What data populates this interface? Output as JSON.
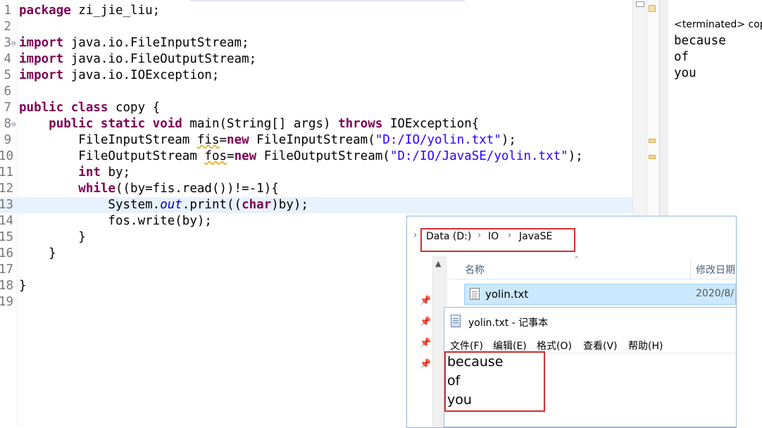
{
  "editor": {
    "lines": [
      {
        "n": "1",
        "html": "<span class='kw'>package</span> zi_jie_liu;"
      },
      {
        "n": "2",
        "html": ""
      },
      {
        "n": "3",
        "html": "<span class='kw'>import</span> java.io.FileInputStream;",
        "fold": true
      },
      {
        "n": "4",
        "html": "<span class='kw'>import</span> java.io.FileOutputStream;"
      },
      {
        "n": "5",
        "html": "<span class='kw'>import</span> java.io.IOException;"
      },
      {
        "n": "6",
        "html": ""
      },
      {
        "n": "7",
        "html": "<span class='kw'>public class</span> copy {"
      },
      {
        "n": "8",
        "html": "    <span class='kw'>public static void</span> main(String[] args) <span class='kw'>throws</span> IOException{",
        "fold": true
      },
      {
        "n": "9",
        "html": "        FileInputStream <span class='warn'>fis</span>=<span class='kw'>new</span> FileInputStream(<span class='str'>\"D:/IO/yolin.txt\"</span>);"
      },
      {
        "n": "10",
        "html": "        FileOutputStream <span class='warn'>fos</span>=<span class='kw'>new</span> FileOutputStream(<span class='str'>\"D:/IO/JavaSE/yolin.txt\"</span>);"
      },
      {
        "n": "11",
        "html": "        <span class='kw'>int</span> by;"
      },
      {
        "n": "12",
        "html": "        <span class='kw'>while</span>((by=fis.read())!=-1){"
      },
      {
        "n": "13",
        "html": "            System.<span class='fld'>out</span>.print((<span class='kw'>char</span>)by);",
        "current": true
      },
      {
        "n": "14",
        "html": "            fos.write(by);"
      },
      {
        "n": "15",
        "html": "        }"
      },
      {
        "n": "16",
        "html": "    }"
      },
      {
        "n": "17",
        "html": ""
      },
      {
        "n": "18",
        "html": "}"
      },
      {
        "n": "19",
        "html": ""
      }
    ]
  },
  "console": {
    "title": "<terminated> cop",
    "output": [
      "because",
      "of",
      "you"
    ]
  },
  "explorer": {
    "breadcrumb": [
      "Data (D:)",
      "IO",
      "JavaSE"
    ],
    "col_name": "名称",
    "col_date": "修改日期",
    "file": {
      "name": "yolin.txt",
      "date": "2020/8/"
    }
  },
  "notepad": {
    "title": "yolin.txt - 记事本",
    "menus": [
      "文件(F)",
      "编辑(E)",
      "格式(O)",
      "查看(V)",
      "帮助(H)"
    ],
    "content": [
      "because",
      "of",
      "you"
    ]
  }
}
